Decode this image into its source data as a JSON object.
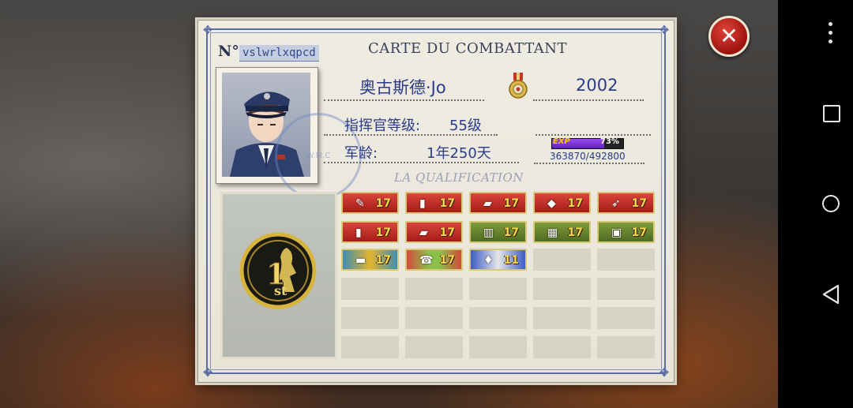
{
  "card": {
    "title": "CARTE DU COMBATTANT",
    "no_label": "N°",
    "serial": "vslwrlxqpcd",
    "name": "奥古斯德·Jo",
    "id_number": "2002",
    "level_label": "指挥官等级:",
    "level_value": "55级",
    "service_label": "军龄:",
    "service_value": "1年250天",
    "exp": {
      "label": "EXP",
      "percent_text": "73%",
      "fraction": 0.73,
      "progress": "363870/492800"
    },
    "qualification_title": "LA QUALIFICATION",
    "stamp_text": "W.M.C",
    "rank_badge": {
      "number": "1",
      "suffix": "st"
    }
  },
  "badges": [
    {
      "icon": "grenade-icon",
      "glyph": "✎",
      "value": "17",
      "style": "red"
    },
    {
      "icon": "rifle-bullet-icon",
      "glyph": "▮",
      "value": "17",
      "style": "red"
    },
    {
      "icon": "shell-icon",
      "glyph": "▰",
      "value": "17",
      "style": "red"
    },
    {
      "icon": "artillery-shell-icon",
      "glyph": "◆",
      "value": "17",
      "style": "red"
    },
    {
      "icon": "rocket-icon",
      "glyph": "➶",
      "value": "17",
      "style": "red"
    },
    {
      "icon": "cartridge-icon",
      "glyph": "▮",
      "value": "17",
      "style": "red"
    },
    {
      "icon": "bullet-icon",
      "glyph": "▰",
      "value": "17",
      "style": "red"
    },
    {
      "icon": "film-icon",
      "glyph": "▥",
      "value": "17",
      "style": "green"
    },
    {
      "icon": "blueprint-icon",
      "glyph": "▦",
      "value": "17",
      "style": "green"
    },
    {
      "icon": "crate-icon",
      "glyph": "▣",
      "value": "17",
      "style": "green"
    },
    {
      "icon": "tank-icon",
      "glyph": "▬",
      "value": "17",
      "style": "teal"
    },
    {
      "icon": "radio-icon",
      "glyph": "☎",
      "value": "17",
      "style": "lime"
    },
    {
      "icon": "lightbulb-icon",
      "glyph": "♦",
      "value": "11",
      "style": "blue"
    }
  ],
  "colors": {
    "ink_blue": "#2a3b8c",
    "frame_blue": "#5c6ea6",
    "close_red": "#c0241b",
    "exp_purple": "#7a3ad6"
  },
  "system_nav": {
    "menu_icon": "more-vert-icon",
    "recents_icon": "recents-square-icon",
    "home_icon": "home-circle-icon",
    "back_icon": "back-triangle-icon"
  }
}
